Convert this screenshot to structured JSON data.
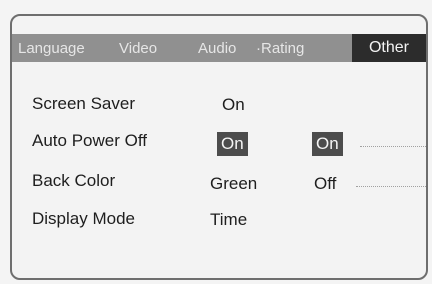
{
  "tabs": {
    "language": "Language",
    "video": "Video",
    "audio": "Audio",
    "rating": "·Rating",
    "other": "Other"
  },
  "settings": [
    {
      "label": "Screen Saver",
      "value": "On"
    },
    {
      "label": "Auto Power Off",
      "value": "On",
      "option": "On"
    },
    {
      "label": "Back Color",
      "value": "Green",
      "option": "Off"
    },
    {
      "label": "Display Mode",
      "value": "Time"
    }
  ],
  "colors": {
    "tab_bar": "#909090",
    "active_tab": "#2c2c2c",
    "highlight": "#4c4c4c"
  }
}
